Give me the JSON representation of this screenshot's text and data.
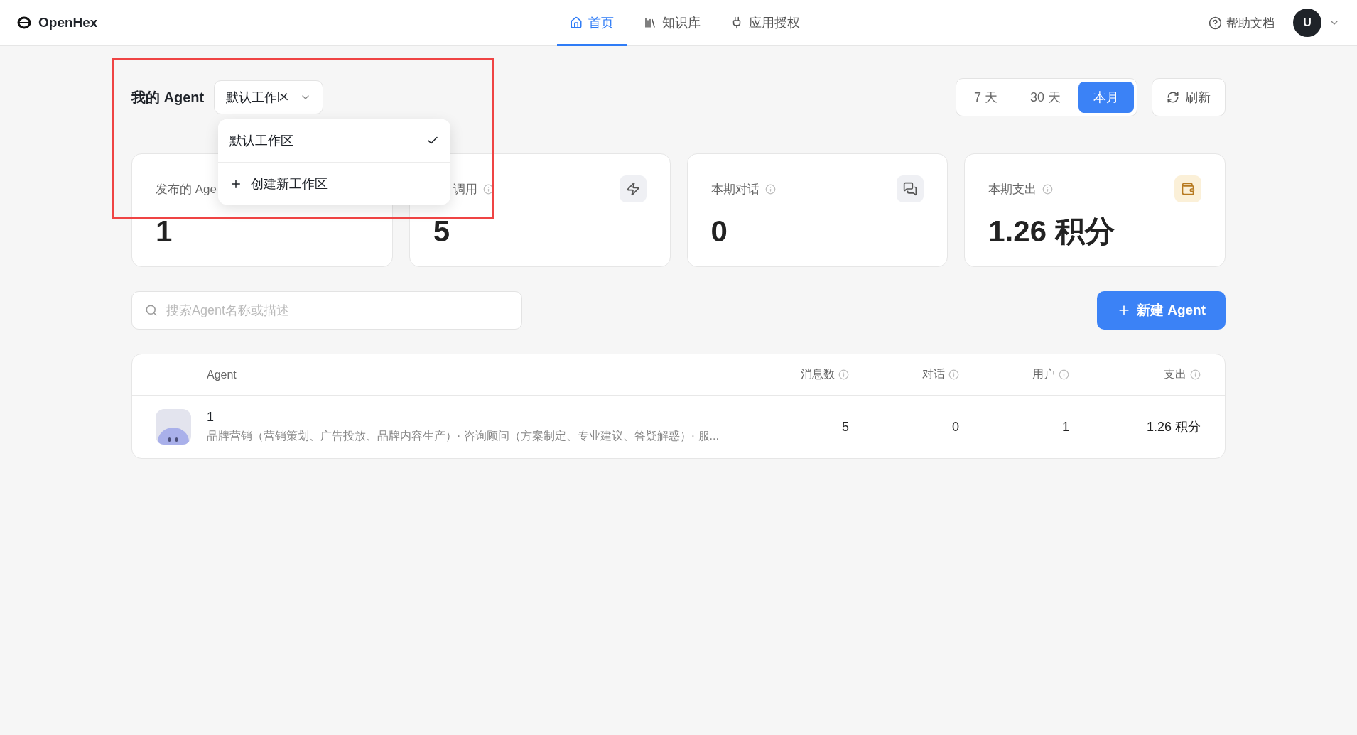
{
  "header": {
    "brand": "OpenHex",
    "nav": [
      {
        "label": "首页",
        "selected": true
      },
      {
        "label": "知识库",
        "selected": false
      },
      {
        "label": "应用授权",
        "selected": false
      }
    ],
    "help": "帮助文档",
    "avatar": "U"
  },
  "toolbar": {
    "title": "我的 Agent",
    "workspace": "默认工作区",
    "ranges": [
      {
        "label": "7 天",
        "selected": false
      },
      {
        "label": "30 天",
        "selected": false
      },
      {
        "label": "本月",
        "selected": true
      }
    ],
    "refresh": "刷新"
  },
  "workspace_menu": {
    "items": [
      {
        "kind": "option",
        "label": "默认工作区",
        "selected": true
      },
      {
        "kind": "create",
        "label": "创建新工作区"
      }
    ]
  },
  "stats": [
    {
      "label": "发布的 Age",
      "value": "1"
    },
    {
      "label": "调用",
      "value": "5"
    },
    {
      "label": "本期对话",
      "value": "0"
    },
    {
      "label": "本期支出",
      "value": "1.26 积分"
    }
  ],
  "search": {
    "placeholder": "搜索Agent名称或描述"
  },
  "new_button": "新建 Agent",
  "table": {
    "columns": [
      "Agent",
      "消息数",
      "对话",
      "用户",
      "支出"
    ],
    "rows": [
      {
        "name": "1",
        "description": "品牌营销（营销策划、广告投放、品牌内容生产）· 咨询顾问（方案制定、专业建议、答疑解惑）· 服...",
        "messages": "5",
        "conversations": "0",
        "users": "1",
        "spend": "1.26 积分"
      }
    ]
  }
}
